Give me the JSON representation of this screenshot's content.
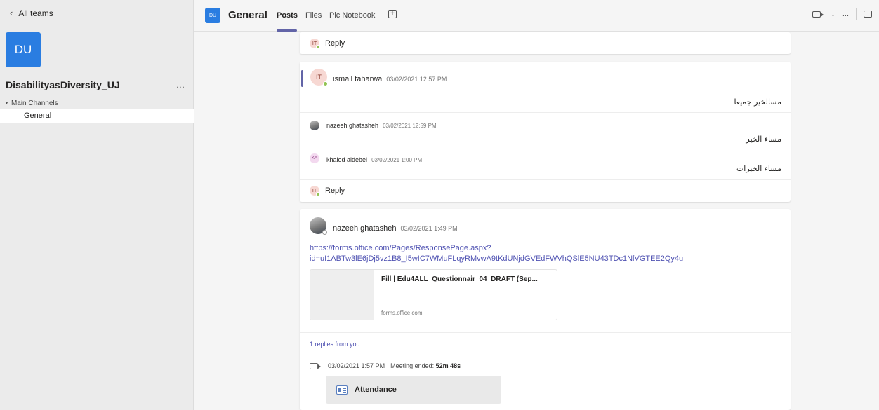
{
  "sidebar": {
    "back_label": "All teams",
    "team_initials": "DU",
    "team_name": "DisabilityasDiversity_UJ",
    "more_label": "...",
    "section_label": "Main Channels",
    "channels": [
      {
        "label": "General",
        "selected": true
      }
    ]
  },
  "header": {
    "channel_initials": "DU",
    "channel_title": "General",
    "tabs": [
      {
        "label": "Posts",
        "active": true
      },
      {
        "label": "Files",
        "active": false
      },
      {
        "label": "Plc Notebook",
        "active": false
      }
    ],
    "add_tab_label": "+",
    "more_label": "...",
    "accent_color": "#6264a7"
  },
  "thread1": {
    "reply_label": "Reply",
    "avatar_initials": "IT"
  },
  "thread2": {
    "root": {
      "avatar_initials": "IT",
      "author": "ismail taharwa",
      "timestamp": "03/02/2021 12:57 PM",
      "text": "مسالخير جميعا"
    },
    "replies": [
      {
        "author": "nazeeh ghatasheh",
        "timestamp": "03/02/2021 12:59 PM",
        "text": "مساء الخير",
        "avatar": "photo"
      },
      {
        "author": "khaled aldebei",
        "timestamp": "03/02/2021 1:00 PM",
        "text": "مساء الخيرات",
        "avatar_initials": "KA"
      }
    ],
    "reply_label": "Reply",
    "reply_avatar_initials": "IT"
  },
  "thread3": {
    "author": "nazeeh ghatasheh",
    "timestamp": "03/02/2021 1:49 PM",
    "link_line1": "https://forms.office.com/Pages/ResponsePage.aspx?",
    "link_line2": "id=uI1ABTw3lE6jDj5vz1B8_I5wIC7WMuFLqyRMvwA9tKdUNjdGVEdFWVhQSlE5NU43TDc1NlVGTEE2Qy4u",
    "preview_title": "Fill | Edu4ALL_Questionnair_04_DRAFT (Sep...",
    "preview_domain": "forms.office.com",
    "replies_label": "1 replies from you",
    "meeting_time": "03/02/2021 1:57 PM",
    "meeting_prefix": "Meeting ended:",
    "meeting_duration": "52m 48s",
    "attendance_label": "Attendance"
  },
  "colors": {
    "team_avatar": "#2a7de1",
    "link": "#4f52b2",
    "presence_available": "#92c353"
  }
}
